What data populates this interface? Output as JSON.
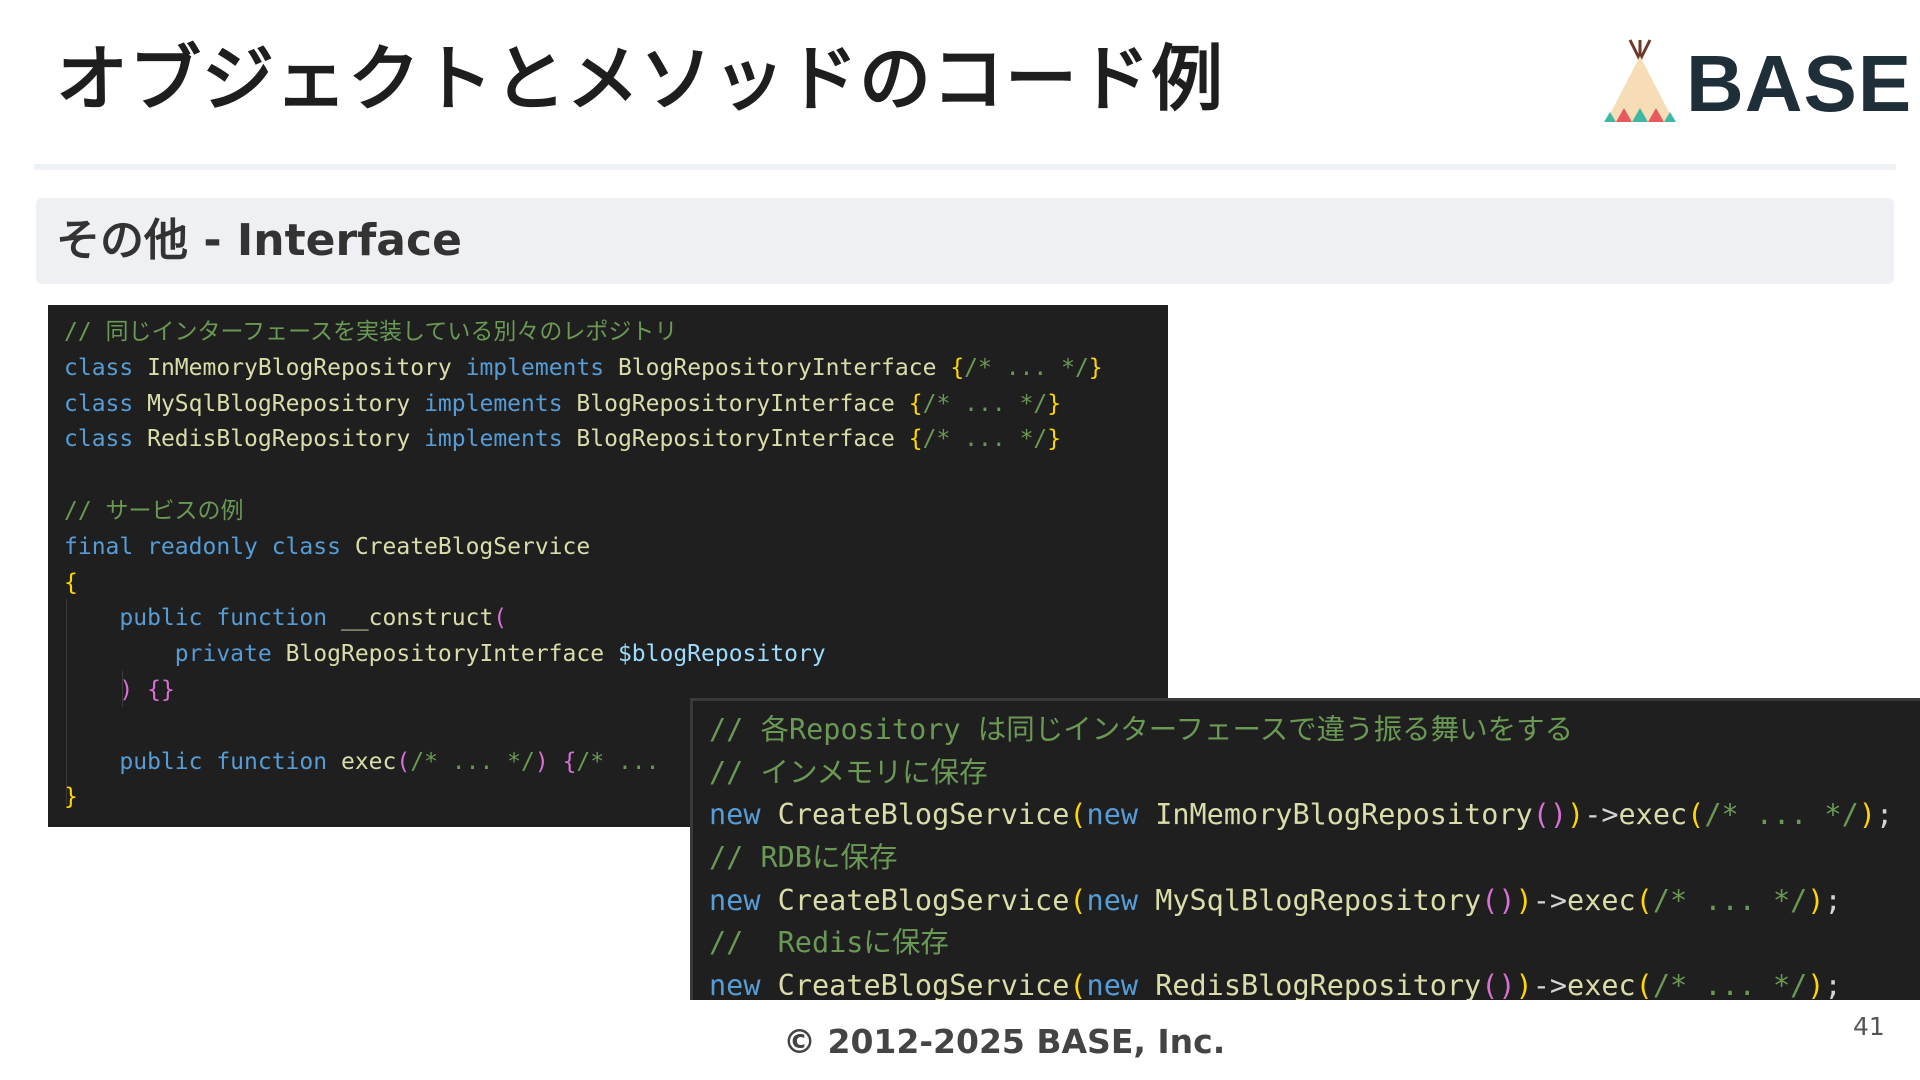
{
  "slide": {
    "title": "オブジェクトとメソッドのコード例",
    "logo_text": "BASE",
    "section_title": "その他 - Interface",
    "copyright": "© 2012-2025 BASE, Inc.",
    "page_number": "41"
  },
  "colors": {
    "comment": "#6a9955",
    "keyword": "#569cd6",
    "class_name": "#dcdcaa",
    "variable": "#9cdcfe",
    "brace": "#ffd700",
    "code_background": "#1f1f1f",
    "logo_text": "#1f2f3a"
  },
  "code_top": [
    [
      {
        "c": "comment",
        "t": "// 同じインターフェースを実装している別々のレポジトリ"
      }
    ],
    [
      {
        "c": "keyword",
        "t": "class"
      },
      {
        "c": "plain",
        "t": " "
      },
      {
        "c": "class",
        "t": "InMemoryBlogRepository"
      },
      {
        "c": "plain",
        "t": " "
      },
      {
        "c": "keyword",
        "t": "implements"
      },
      {
        "c": "plain",
        "t": " "
      },
      {
        "c": "class",
        "t": "BlogRepositoryInterface"
      },
      {
        "c": "plain",
        "t": " "
      },
      {
        "c": "brace",
        "t": "{"
      },
      {
        "c": "comment",
        "t": "/* ... */"
      },
      {
        "c": "brace",
        "t": "}"
      }
    ],
    [
      {
        "c": "keyword",
        "t": "class"
      },
      {
        "c": "plain",
        "t": " "
      },
      {
        "c": "class",
        "t": "MySqlBlogRepository"
      },
      {
        "c": "plain",
        "t": " "
      },
      {
        "c": "keyword",
        "t": "implements"
      },
      {
        "c": "plain",
        "t": " "
      },
      {
        "c": "class",
        "t": "BlogRepositoryInterface"
      },
      {
        "c": "plain",
        "t": " "
      },
      {
        "c": "brace",
        "t": "{"
      },
      {
        "c": "comment",
        "t": "/* ... */"
      },
      {
        "c": "brace",
        "t": "}"
      }
    ],
    [
      {
        "c": "keyword",
        "t": "class"
      },
      {
        "c": "plain",
        "t": " "
      },
      {
        "c": "class",
        "t": "RedisBlogRepository"
      },
      {
        "c": "plain",
        "t": " "
      },
      {
        "c": "keyword",
        "t": "implements"
      },
      {
        "c": "plain",
        "t": " "
      },
      {
        "c": "class",
        "t": "BlogRepositoryInterface"
      },
      {
        "c": "plain",
        "t": " "
      },
      {
        "c": "brace",
        "t": "{"
      },
      {
        "c": "comment",
        "t": "/* ... */"
      },
      {
        "c": "brace",
        "t": "}"
      }
    ],
    [],
    [
      {
        "c": "comment",
        "t": "// サービスの例"
      }
    ],
    [
      {
        "c": "keyword",
        "t": "final readonly class"
      },
      {
        "c": "plain",
        "t": " "
      },
      {
        "c": "class",
        "t": "CreateBlogService"
      }
    ],
    [
      {
        "c": "brace",
        "t": "{"
      }
    ],
    [
      {
        "c": "plain",
        "t": "    "
      },
      {
        "c": "keyword",
        "t": "public function"
      },
      {
        "c": "plain",
        "t": " "
      },
      {
        "c": "func",
        "t": "__construct"
      },
      {
        "c": "brace2",
        "t": "("
      }
    ],
    [
      {
        "c": "plain",
        "t": "        "
      },
      {
        "c": "keyword",
        "t": "private"
      },
      {
        "c": "plain",
        "t": " "
      },
      {
        "c": "type",
        "t": "BlogRepositoryInterface"
      },
      {
        "c": "plain",
        "t": " "
      },
      {
        "c": "var",
        "t": "$blogRepository"
      }
    ],
    [
      {
        "c": "plain",
        "t": "    "
      },
      {
        "c": "brace2",
        "t": ")"
      },
      {
        "c": "plain",
        "t": " "
      },
      {
        "c": "brace2",
        "t": "{}"
      }
    ],
    [],
    [
      {
        "c": "plain",
        "t": "    "
      },
      {
        "c": "keyword",
        "t": "public function"
      },
      {
        "c": "plain",
        "t": " "
      },
      {
        "c": "func",
        "t": "exec"
      },
      {
        "c": "brace2",
        "t": "("
      },
      {
        "c": "comment",
        "t": "/* ... */"
      },
      {
        "c": "brace2",
        "t": ")"
      },
      {
        "c": "plain",
        "t": " "
      },
      {
        "c": "brace2",
        "t": "{"
      },
      {
        "c": "comment",
        "t": "/* ..."
      }
    ],
    [
      {
        "c": "brace",
        "t": "}"
      }
    ]
  ],
  "code_bottom": [
    [
      {
        "c": "comment",
        "t": "// 各Repository は同じインターフェースで違う振る舞いをする"
      }
    ],
    [
      {
        "c": "comment",
        "t": "// インメモリに保存"
      }
    ],
    [
      {
        "c": "keyword",
        "t": "new"
      },
      {
        "c": "plain",
        "t": " "
      },
      {
        "c": "class",
        "t": "CreateBlogService"
      },
      {
        "c": "brace",
        "t": "("
      },
      {
        "c": "keyword",
        "t": "new"
      },
      {
        "c": "plain",
        "t": " "
      },
      {
        "c": "class",
        "t": "InMemoryBlogRepository"
      },
      {
        "c": "brace2",
        "t": "()"
      },
      {
        "c": "brace",
        "t": ")"
      },
      {
        "c": "plain",
        "t": "->"
      },
      {
        "c": "func",
        "t": "exec"
      },
      {
        "c": "brace",
        "t": "("
      },
      {
        "c": "comment",
        "t": "/* ... */"
      },
      {
        "c": "brace",
        "t": ")"
      },
      {
        "c": "plain",
        "t": ";"
      }
    ],
    [
      {
        "c": "comment",
        "t": "// RDBに保存"
      }
    ],
    [
      {
        "c": "keyword",
        "t": "new"
      },
      {
        "c": "plain",
        "t": " "
      },
      {
        "c": "class",
        "t": "CreateBlogService"
      },
      {
        "c": "brace",
        "t": "("
      },
      {
        "c": "keyword",
        "t": "new"
      },
      {
        "c": "plain",
        "t": " "
      },
      {
        "c": "class",
        "t": "MySqlBlogRepository"
      },
      {
        "c": "brace2",
        "t": "()"
      },
      {
        "c": "brace",
        "t": ")"
      },
      {
        "c": "plain",
        "t": "->"
      },
      {
        "c": "func",
        "t": "exec"
      },
      {
        "c": "brace",
        "t": "("
      },
      {
        "c": "comment",
        "t": "/* ... */"
      },
      {
        "c": "brace",
        "t": ")"
      },
      {
        "c": "plain",
        "t": ";"
      }
    ],
    [
      {
        "c": "comment",
        "t": "//  Redisに保存"
      }
    ],
    [
      {
        "c": "keyword",
        "t": "new"
      },
      {
        "c": "plain",
        "t": " "
      },
      {
        "c": "class",
        "t": "CreateBlogService"
      },
      {
        "c": "brace",
        "t": "("
      },
      {
        "c": "keyword",
        "t": "new"
      },
      {
        "c": "plain",
        "t": " "
      },
      {
        "c": "class",
        "t": "RedisBlogRepository"
      },
      {
        "c": "brace2",
        "t": "()"
      },
      {
        "c": "brace",
        "t": ")"
      },
      {
        "c": "plain",
        "t": "->"
      },
      {
        "c": "func",
        "t": "exec"
      },
      {
        "c": "brace",
        "t": "("
      },
      {
        "c": "comment",
        "t": "/* ... */"
      },
      {
        "c": "brace",
        "t": ")"
      },
      {
        "c": "plain",
        "t": ";"
      }
    ]
  ]
}
